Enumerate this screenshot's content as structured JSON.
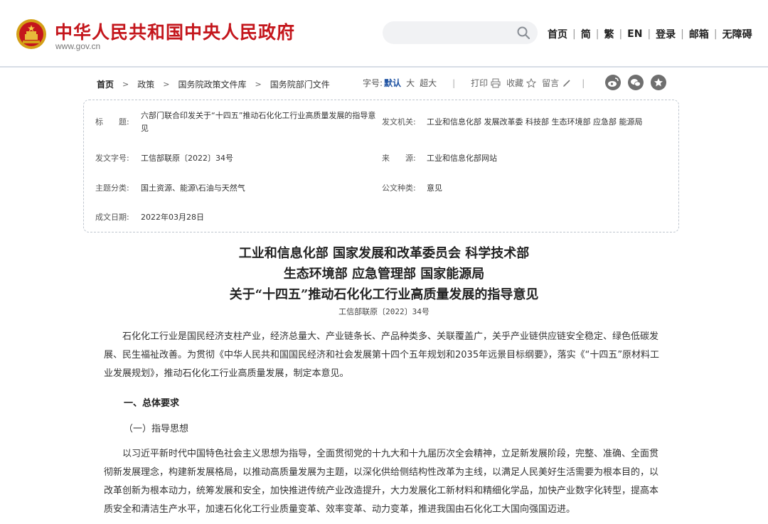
{
  "header": {
    "site_title": "中华人民共和国中央人民政府",
    "site_url": "www.gov.cn",
    "search_placeholder": "",
    "nav": [
      "首页",
      "简",
      "繁",
      "EN",
      "登录",
      "邮箱",
      "无障碍"
    ],
    "brand_color": "#c4161c"
  },
  "breadcrumb": {
    "items": [
      "首页",
      "政策",
      "国务院政策文件库",
      "国务院部门文件"
    ]
  },
  "tools": {
    "font_label": "字号:",
    "font_default": "默认",
    "font_large": "大",
    "font_xlarge": "超大",
    "print": "打印",
    "favorite": "收藏",
    "comment": "留言",
    "share": [
      "weibo-icon",
      "wechat-icon",
      "star-icon"
    ]
  },
  "info": {
    "title_label": "标　　题:",
    "title_value": "六部门联合印发关于“十四五”推动石化化工行业高质量发展的指导意见",
    "issuer_label": "发文机关:",
    "issuer_value": "工业和信息化部 发展改革委 科技部 生态环境部 应急部 能源局",
    "docno_label": "发文字号:",
    "docno_value": "工信部联原〔2022〕34号",
    "source_label": "来　　源:",
    "source_value": "工业和信息化部网站",
    "topic_label": "主题分类:",
    "topic_value": "国土资源、能源\\石油与天然气",
    "type_label": "公文种类:",
    "type_value": "意见",
    "date_label": "成文日期:",
    "date_value": "2022年03月28日"
  },
  "doc": {
    "title_line1": "工业和信息化部 国家发展和改革委员会 科学技术部",
    "title_line2": "生态环境部 应急管理部 国家能源局",
    "title_line3": "关于“十四五”推动石化化工行业高质量发展的指导意见",
    "doc_number": "工信部联原〔2022〕34号",
    "para1": "石化化工行业是国民经济支柱产业，经济总量大、产业链条长、产品种类多、关联覆盖广，关乎产业链供应链安全稳定、绿色低碳发展、民生福祉改善。为贯彻《中华人民共和国国民经济和社会发展第十四个五年规划和2035年远景目标纲要》，落实《“十四五”原材料工业发展规划》，推动石化化工行业高质量发展，制定本意见。",
    "section1": "一、总体要求",
    "sub1": "（一）指导思想",
    "para2": "以习近平新时代中国特色社会主义思想为指导，全面贯彻党的十九大和十九届历次全会精神，立足新发展阶段，完整、准确、全面贯彻新发展理念，构建新发展格局，以推动高质量发展为主题，以深化供给侧结构性改革为主线，以满足人民美好生活需要为根本目的，以改革创新为根本动力，统筹发展和安全，加快推进传统产业改造提升，大力发展化工新材料和精细化学品，加快产业数字化转型，提高本质安全和清洁生产水平，加速石化化工行业质量变革、效率变革、动力变革，推进我国由石化化工大国向强国迈进。"
  }
}
